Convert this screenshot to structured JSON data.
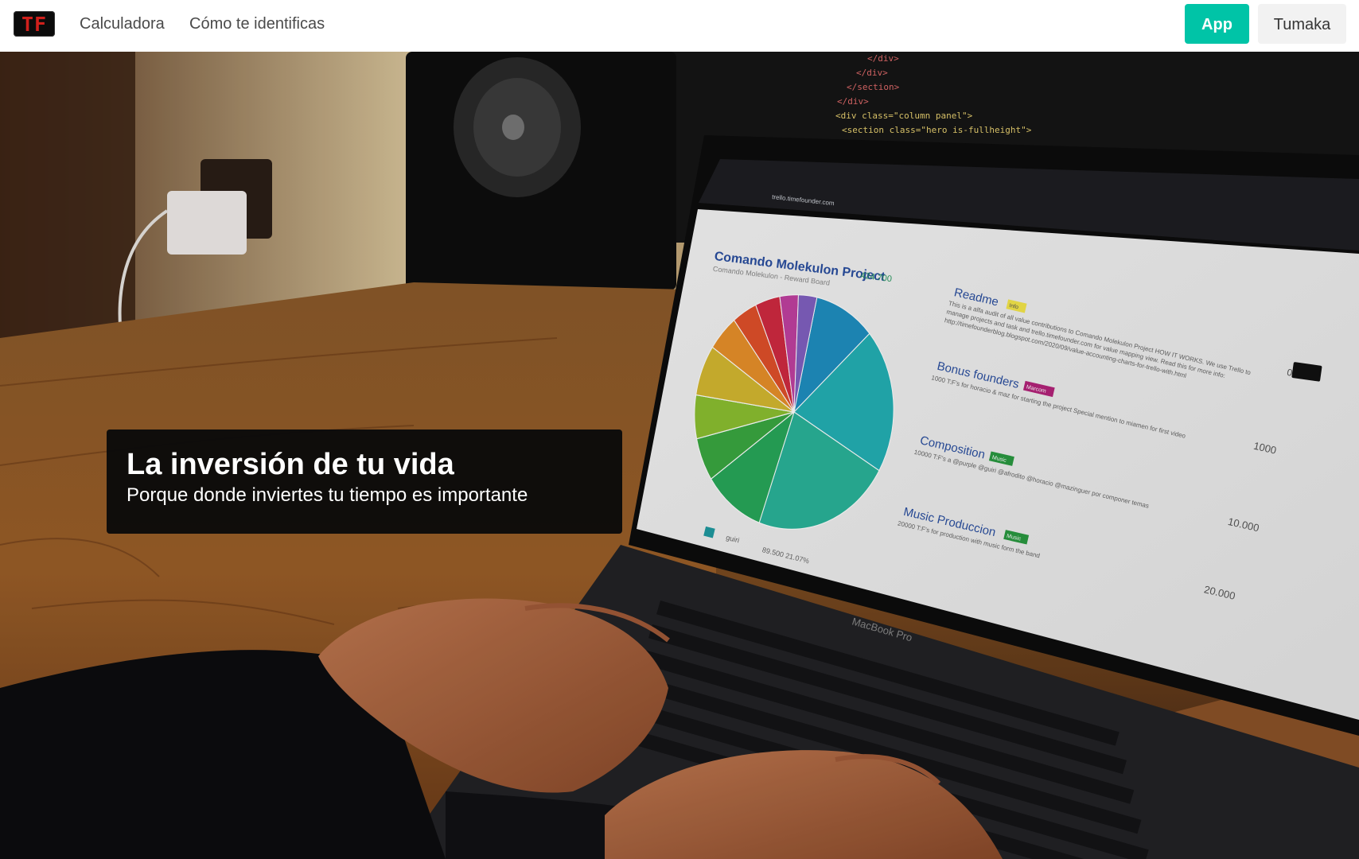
{
  "navbar": {
    "logo_text": "TF",
    "links": [
      {
        "label": "Calculadora"
      },
      {
        "label": "Cómo te identificas"
      }
    ],
    "app_button_label": "App",
    "user_button_label": "Tumaka"
  },
  "hero": {
    "title": "La inversión de tu vida",
    "subtitle": "Porque donde inviertes tu tiempo es importante",
    "photo": {
      "code_lines": [
        "</div>",
        "</div>",
        "</section>",
        "</div>",
        "<div class=\"column panel\">",
        "<section class=\"hero is-fullheight\">"
      ],
      "laptop_brand": "MacBook Pro",
      "screen": {
        "url": "trello.timefounder.com",
        "project_title": "Comando Molekulon Project",
        "project_subtitle": "Comando Molekulon - Reward Board",
        "project_total": "424.700",
        "pie_legend": "guiri",
        "pie_caption": "89.500  21.07%",
        "cards": [
          {
            "title": "Readme",
            "tag": "Info",
            "value": "0",
            "text": "This is a alfa audit of all value contributions to Comando Molekulon Project HOW IT WORKS. We use Trello to manage projects and task and trello.timefounder.com for value mapping view. Read this for more info: http://timefounderblog.blogspot.com/2020/09/value-accounting-charts-for-trello-with.html"
          },
          {
            "title": "Bonus founders",
            "tag": "Marcom",
            "value": "1000",
            "text": "1000 T:F's for horacio & maz for starting the project Special mention to miamen for first video"
          },
          {
            "title": "Composition",
            "tag": "Music",
            "value": "10.000",
            "text": "10000 T:F's a @purple @guiri @afrodito @horacio @mazinguer por componer temas"
          },
          {
            "title": "Music Produccion",
            "tag": "Music",
            "value": "20.000",
            "text": "20000 T:F's for production with music form the band"
          }
        ]
      }
    }
  },
  "colors": {
    "accent": "#00c4a7",
    "logo_red": "#d0201c",
    "pie": [
      "#1f8fc0",
      "#23b0b5",
      "#2ab39a",
      "#28a85a",
      "#3aa840",
      "#8bbf30",
      "#d4b830",
      "#e8902a",
      "#e0502a",
      "#d02a40",
      "#c040a0",
      "#8060c0"
    ]
  }
}
